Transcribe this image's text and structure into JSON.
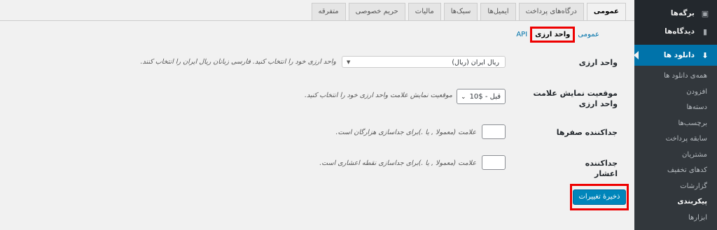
{
  "menu": {
    "top_items": [
      {
        "label": "برگه‌ها",
        "icon": "pages-icon"
      },
      {
        "label": "دیدگاه‌ها",
        "icon": "comments-icon"
      }
    ],
    "current": {
      "label": "دانلود ها",
      "icon": "download-icon"
    },
    "sub_items": [
      "همه‌ی دانلود ها",
      "افزودن",
      "دسته‌ها",
      "برچسب‌ها",
      "سابقه پرداخت",
      "مشتریان",
      "کدهای تخفیف",
      "گزارشات",
      "پیکربندی",
      "ابزارها"
    ],
    "active_sub": "پیکربندی"
  },
  "tabs": [
    "عمومی",
    "درگاه‌های پرداخت",
    "ایمیل‌ها",
    "سبک‌ها",
    "مالیات",
    "حریم خصوصی",
    "متفرقه"
  ],
  "subnav": {
    "current": "واحد ارزی",
    "links": [
      "عمومی",
      "API"
    ]
  },
  "fields": {
    "currency": {
      "label": "واحد ارزی",
      "value": "ریال ایران (ریال)",
      "desc": "واحد ارزی خود را انتخاب کنید. فارسی زبانان ریال ایران را انتخاب کنند."
    },
    "position": {
      "label": "موقعیت نمایش علامت واحد ارزی",
      "value": "قبل - $10",
      "desc": "موقعیت نمایش علامت واحد ارزی خود را انتخاب کنید."
    },
    "zeros": {
      "label": "جداکننده صفرها",
      "desc": "علامت (معمولا , یا .)برای جداسازی هزارگان است."
    },
    "decimal": {
      "label": "جداکننده اعشار",
      "desc": "علامت (معمولا , یا .)برای جداسازی نقطه اعشاری است."
    }
  },
  "save_label": "ذخیرهٔ تغییرات"
}
